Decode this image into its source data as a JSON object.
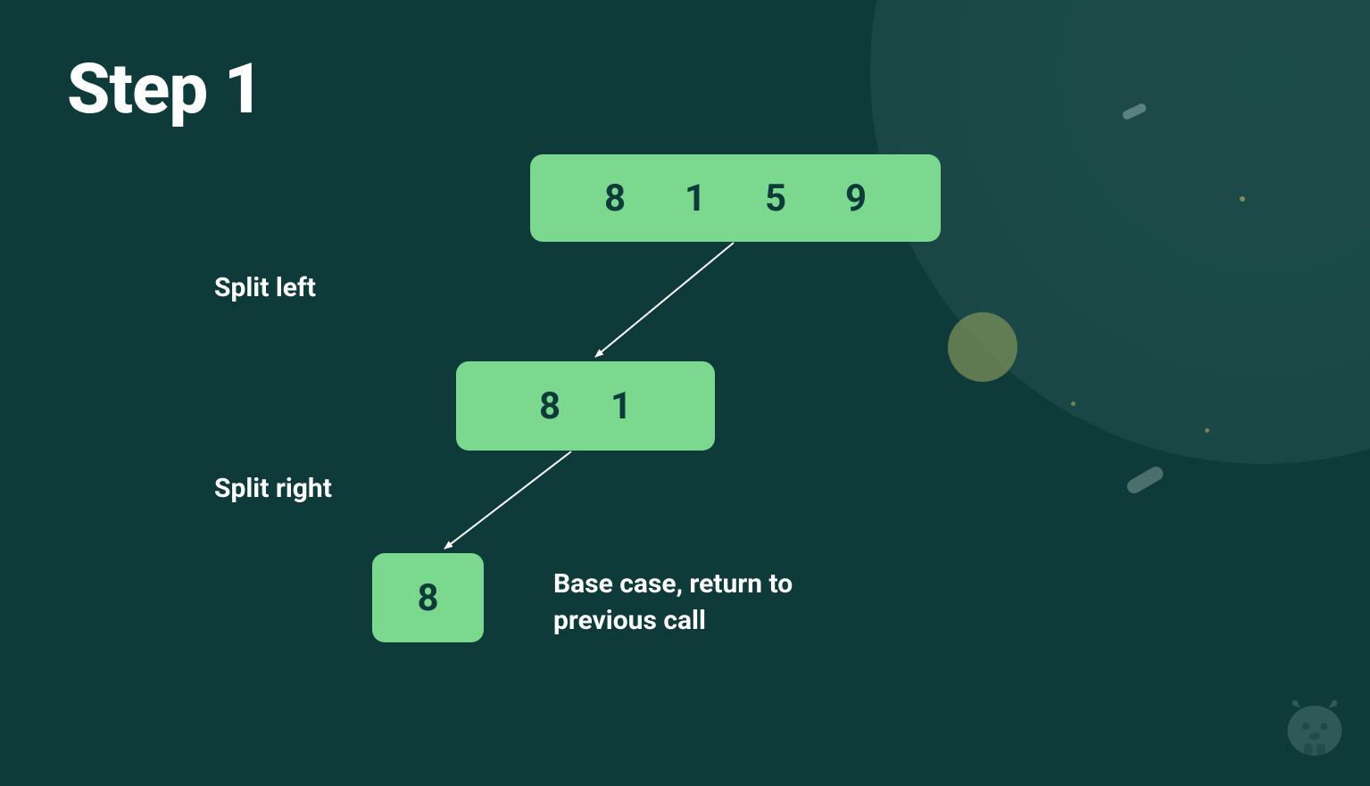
{
  "title": "Step 1",
  "labels": {
    "split_left": "Split left",
    "split_right": "Split right"
  },
  "arrays": {
    "level0": [
      "8",
      "1",
      "5",
      "9"
    ],
    "level1": [
      "8",
      "1"
    ],
    "level2": [
      "8"
    ]
  },
  "caption_line1": "Base case, return to",
  "caption_line2": "previous call",
  "colors": {
    "background": "#0e3a3a",
    "box": "#7bd88f",
    "box_text": "#0e3a3a",
    "text": "#ffffff"
  }
}
